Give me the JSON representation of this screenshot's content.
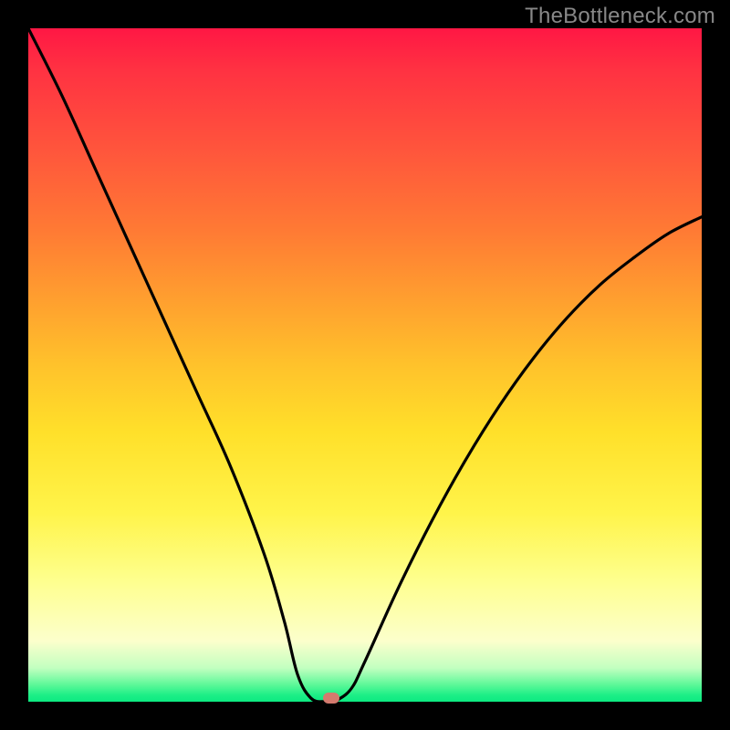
{
  "watermark": "TheBottleneck.com",
  "chart_data": {
    "type": "line",
    "title": "",
    "xlabel": "",
    "ylabel": "",
    "xlim": [
      0,
      100
    ],
    "ylim": [
      0,
      100
    ],
    "series": [
      {
        "name": "bottleneck-curve",
        "x": [
          0,
          5,
          10,
          15,
          20,
          25,
          30,
          35,
          38,
          40,
          42,
          44,
          45,
          46,
          48,
          50,
          55,
          60,
          65,
          70,
          75,
          80,
          85,
          90,
          95,
          100
        ],
        "y": [
          100,
          90,
          79,
          68,
          57,
          46,
          35,
          22,
          12,
          4,
          0.5,
          0,
          0,
          0.3,
          2,
          6,
          17,
          27,
          36,
          44,
          51,
          57,
          62,
          66,
          69.5,
          72
        ]
      }
    ],
    "marker": {
      "x": 45,
      "y": 0.5
    },
    "gradient": {
      "top_color": "#ff1744",
      "mid_color": "#ffe02a",
      "bottom_color": "#0ce981"
    }
  }
}
